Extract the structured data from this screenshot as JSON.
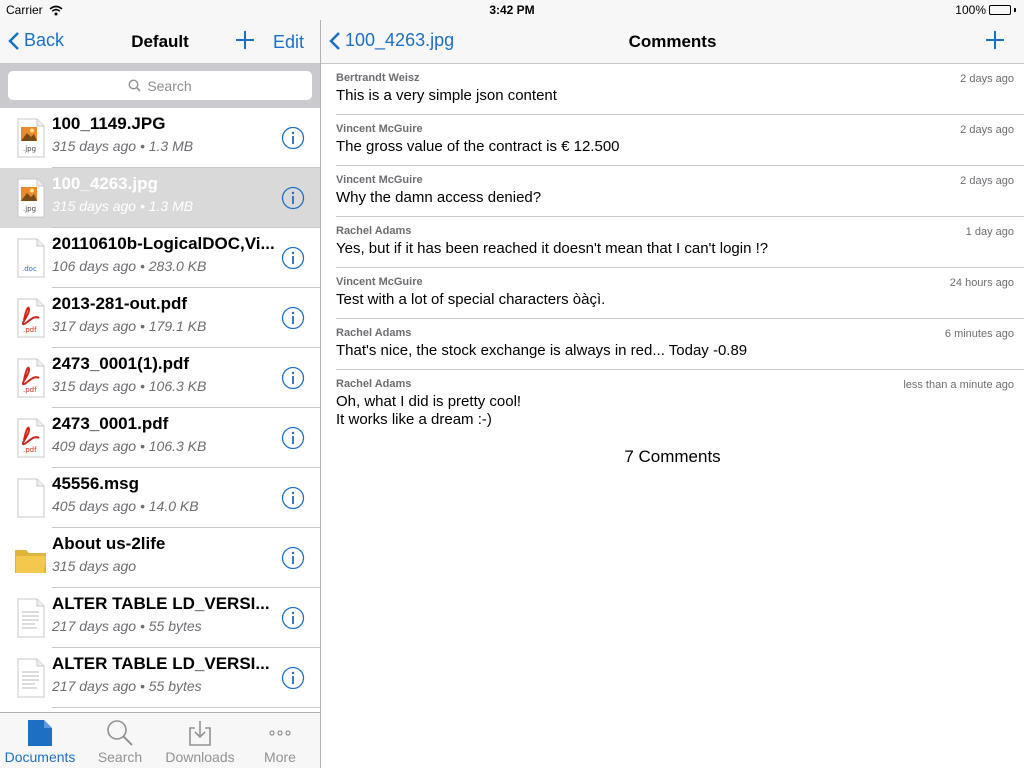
{
  "status": {
    "carrier": "Carrier",
    "time": "3:42 PM",
    "battery": "100%"
  },
  "left_nav": {
    "back_label": "Back",
    "title": "Default",
    "edit_label": "Edit"
  },
  "search": {
    "placeholder": "Search"
  },
  "files": [
    {
      "name": "100_1149.JPG",
      "meta": "315 days ago • 1.3 MB",
      "icon": "jpg-file-icon",
      "selected": false
    },
    {
      "name": "100_4263.jpg",
      "meta": "315 days ago • 1.3 MB",
      "icon": "jpg-file-icon",
      "selected": true
    },
    {
      "name": "20110610b-LogicalDOC,Vi...",
      "meta": "106 days ago • 283.0 KB",
      "icon": "doc-file-icon",
      "selected": false
    },
    {
      "name": "2013-281-out.pdf",
      "meta": "317 days ago • 179.1 KB",
      "icon": "pdf-file-icon",
      "selected": false
    },
    {
      "name": "2473_0001(1).pdf",
      "meta": "315 days ago • 106.3 KB",
      "icon": "pdf-file-icon",
      "selected": false
    },
    {
      "name": "2473_0001.pdf",
      "meta": "409 days ago • 106.3 KB",
      "icon": "pdf-file-icon",
      "selected": false
    },
    {
      "name": "45556.msg",
      "meta": "405 days ago • 14.0 KB",
      "icon": "blank-file-icon",
      "selected": false
    },
    {
      "name": "About us-2life",
      "meta": "315 days ago",
      "icon": "folder-icon",
      "selected": false
    },
    {
      "name": "ALTER TABLE LD_VERSI...",
      "meta": "217 days ago • 55 bytes",
      "icon": "text-file-icon",
      "selected": false
    },
    {
      "name": "ALTER TABLE LD_VERSI...",
      "meta": "217 days ago • 55 bytes",
      "icon": "text-file-icon",
      "selected": false
    }
  ],
  "tabs": [
    {
      "label": "Documents",
      "icon": "documents-icon",
      "active": true
    },
    {
      "label": "Search",
      "icon": "magnifier-icon",
      "active": false
    },
    {
      "label": "Downloads",
      "icon": "download-icon",
      "active": false
    },
    {
      "label": "More",
      "icon": "more-dots-icon",
      "active": false
    }
  ],
  "right_nav": {
    "back_label": "100_4263.jpg",
    "title": "Comments"
  },
  "comments": [
    {
      "author": "Bertrandt Weisz",
      "when": "2 days ago",
      "text": "This is a very simple json content"
    },
    {
      "author": "Vincent McGuire",
      "when": "2 days ago",
      "text": "The gross value of the contract is € 12.500"
    },
    {
      "author": "Vincent McGuire",
      "when": "2 days ago",
      "text": "Why the damn access denied?"
    },
    {
      "author": "Rachel Adams",
      "when": "1 day ago",
      "text": "Yes, but if it has been reached it doesn't mean that I can't login !?"
    },
    {
      "author": "Vincent McGuire",
      "when": "24 hours ago",
      "text": "Test with a lot of special characters òàçì."
    },
    {
      "author": "Rachel Adams",
      "when": "6 minutes ago",
      "text": "That's nice, the stock exchange is always in red... Today -0.89"
    },
    {
      "author": "Rachel Adams",
      "when": "less than a minute ago",
      "text": "Oh, what I did is pretty cool!\nIt works like a dream :-)"
    }
  ],
  "comment_count": "7 Comments",
  "colors": {
    "accent": "#1d6fc4",
    "selected_row": "#d9d9d9",
    "pdf_red": "#d0271c",
    "folder": "#f2c94c"
  }
}
